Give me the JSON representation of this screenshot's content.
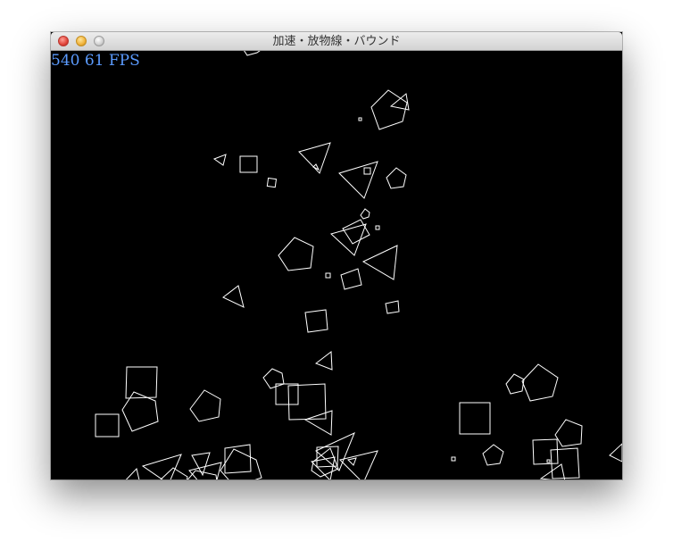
{
  "window": {
    "title": "加速・放物線・バウンド"
  },
  "hud": {
    "particle_count": "540",
    "fps": "61",
    "fps_label": "540 61 FPS"
  },
  "colors": {
    "background": "#000000",
    "shape_stroke": "#ffffff",
    "hud_text": "#5b9bff"
  }
}
